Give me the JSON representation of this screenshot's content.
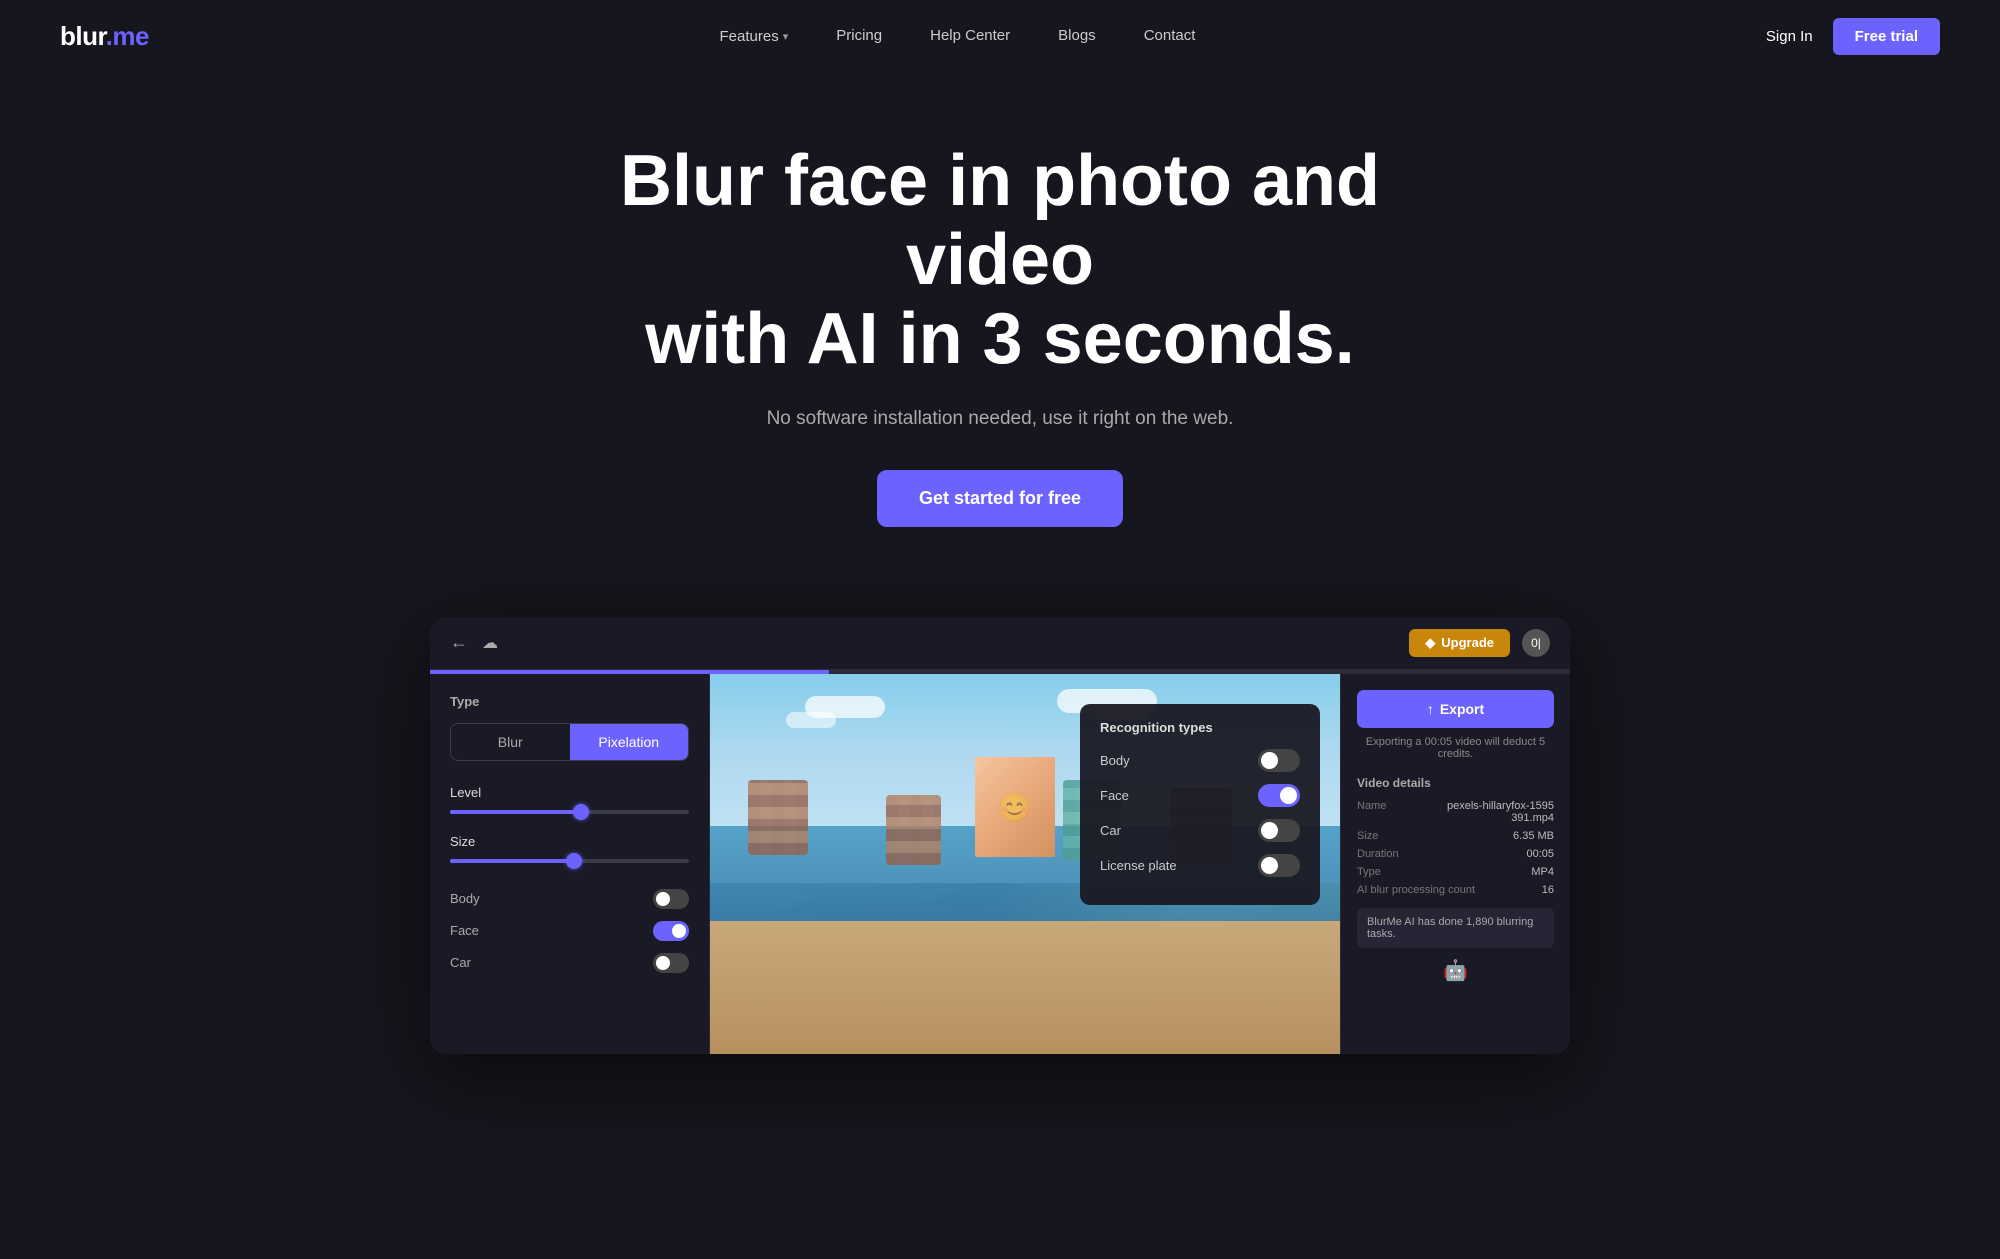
{
  "nav": {
    "logo_blur": "blur",
    "logo_dot": ".",
    "logo_me": "me",
    "links": [
      {
        "id": "features",
        "label": "Features",
        "has_chevron": true
      },
      {
        "id": "pricing",
        "label": "Pricing",
        "has_chevron": false
      },
      {
        "id": "help-center",
        "label": "Help Center",
        "has_chevron": false
      },
      {
        "id": "blogs",
        "label": "Blogs",
        "has_chevron": false
      },
      {
        "id": "contact",
        "label": "Contact",
        "has_chevron": false
      }
    ],
    "sign_in_label": "Sign In",
    "free_trial_label": "Free trial"
  },
  "hero": {
    "heading_line1": "Blur face in photo and video",
    "heading_line2": "with AI in 3 seconds.",
    "subheading": "No software installation needed, use it right on the web.",
    "cta_label": "Get started for free"
  },
  "preview": {
    "upgrade_label": "Upgrade",
    "avatar_text": "0|",
    "export_label": "Export",
    "export_note": "Exporting a 00:05 video will deduct 5 credits.",
    "type_section": "Type",
    "type_blur": "Blur",
    "type_pixelation": "Pixelation",
    "level_label": "Level",
    "size_label": "Size",
    "recognition": {
      "title": "Recognition types",
      "items": [
        {
          "label": "Body",
          "state": "off"
        },
        {
          "label": "Face",
          "state": "on"
        },
        {
          "label": "Car",
          "state": "off"
        },
        {
          "label": "License plate",
          "state": "off"
        }
      ]
    },
    "video_details": {
      "title": "Video details",
      "rows": [
        {
          "key": "Name",
          "value": "pexels-hillaryfox-1595391.mp4"
        },
        {
          "key": "Size",
          "value": "6.35 MB"
        },
        {
          "key": "Duration",
          "value": "00:05"
        },
        {
          "key": "Type",
          "value": "MP4"
        },
        {
          "key": "AI blur processing count",
          "value": "16"
        }
      ]
    },
    "ai_message": "BlurMe AI has done 1,890 blurring tasks.",
    "extra_rows": [
      {
        "label": "Body",
        "state": "off"
      },
      {
        "label": "Face",
        "state": "on"
      },
      {
        "label": "Car",
        "state": "off"
      }
    ]
  }
}
